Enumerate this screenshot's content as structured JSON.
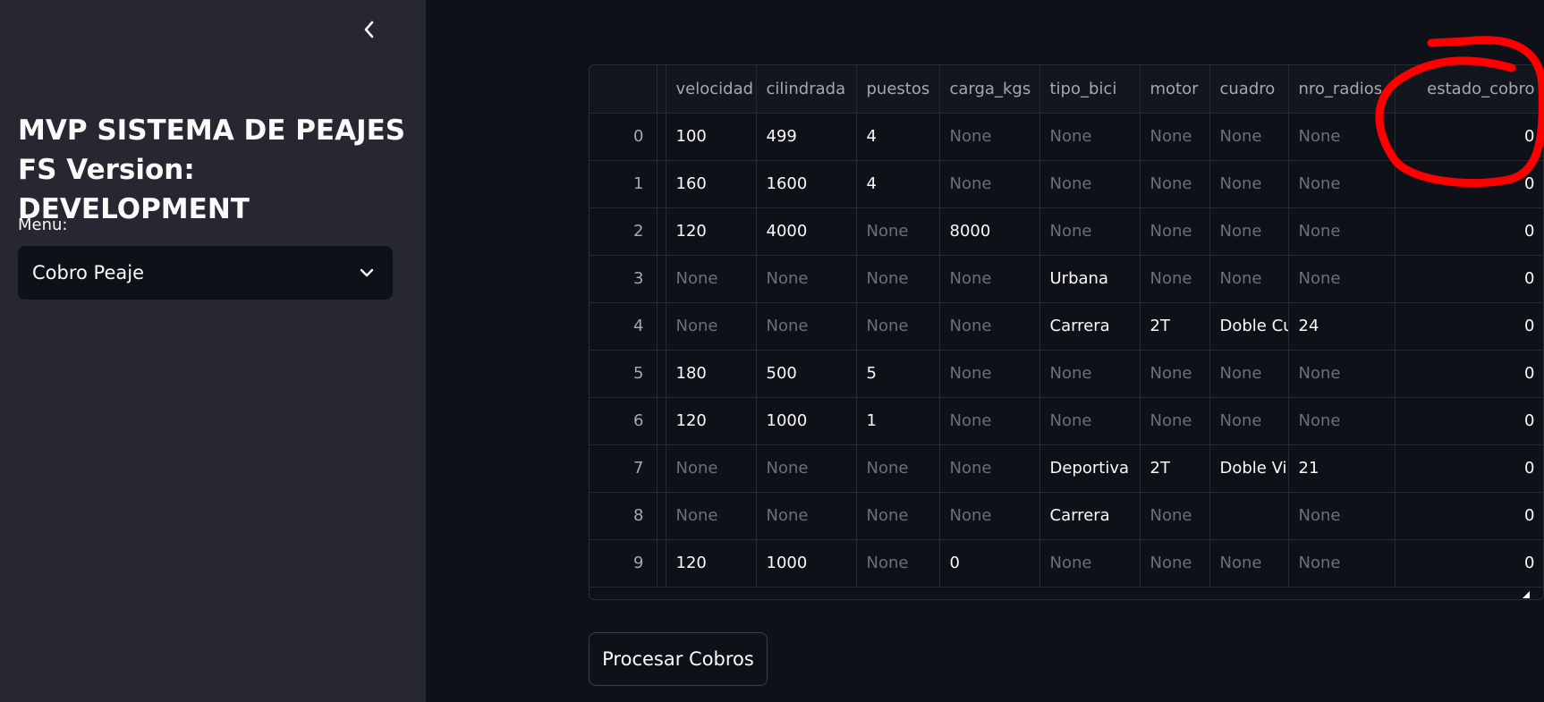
{
  "sidebar": {
    "title_line1": "MVP SISTEMA DE PEAJES",
    "title_line2": "FS Version: DEVELOPMENT",
    "menu_label": "Menu:",
    "menu_selected": "Cobro Peaje",
    "collapse_icon": "chevron-left-icon"
  },
  "table": {
    "columns": [
      "",
      "velocidad",
      "cilindrada",
      "puestos",
      "carga_kgs",
      "tipo_bici",
      "motor",
      "cuadro",
      "nro_radios",
      "estado_cobro"
    ],
    "rows": [
      [
        "0",
        "100",
        "499",
        "4",
        "None",
        "None",
        "None",
        "None",
        "None",
        "0"
      ],
      [
        "1",
        "160",
        "1600",
        "4",
        "None",
        "None",
        "None",
        "None",
        "None",
        "0"
      ],
      [
        "2",
        "120",
        "4000",
        "None",
        "8000",
        "None",
        "None",
        "None",
        "None",
        "0"
      ],
      [
        "3",
        "None",
        "None",
        "None",
        "None",
        "Urbana",
        "None",
        "None",
        "None",
        "0"
      ],
      [
        "4",
        "None",
        "None",
        "None",
        "None",
        "Carrera",
        "2T",
        "Doble Cu",
        "24",
        "0"
      ],
      [
        "5",
        "180",
        "500",
        "5",
        "None",
        "None",
        "None",
        "None",
        "None",
        "0"
      ],
      [
        "6",
        "120",
        "1000",
        "1",
        "None",
        "None",
        "None",
        "None",
        "None",
        "0"
      ],
      [
        "7",
        "None",
        "None",
        "None",
        "None",
        "Deportiva",
        "2T",
        "Doble Vi",
        "21",
        "0"
      ],
      [
        "8",
        "None",
        "None",
        "None",
        "None",
        "Carrera",
        "None",
        "",
        "None",
        "0"
      ],
      [
        "9",
        "120",
        "1000",
        "None",
        "0",
        "None",
        "None",
        "None",
        "None",
        "0"
      ]
    ]
  },
  "actions": {
    "process_button": "Procesar Cobros"
  },
  "colors": {
    "sidebar_bg": "#262730",
    "main_bg": "#0e1117",
    "annotation": "#ff0000"
  }
}
